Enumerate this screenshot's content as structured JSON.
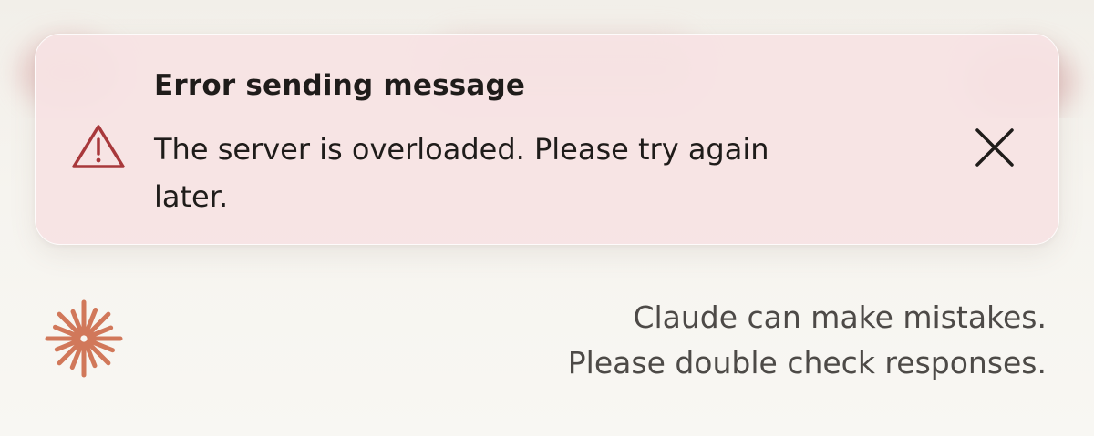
{
  "error_toast": {
    "title": "Error sending message",
    "message": "The server is overloaded. Please try again later.",
    "icon": "warning-triangle-icon",
    "close_icon": "close-icon",
    "icon_color": "#a8383b",
    "background_color": "#f6e2e3"
  },
  "footer": {
    "logo_icon": "claude-starburst-icon",
    "logo_color": "#d1785a",
    "disclaimer_line_1": "Claude can make mistakes.",
    "disclaimer_line_2": "Please double check responses."
  }
}
